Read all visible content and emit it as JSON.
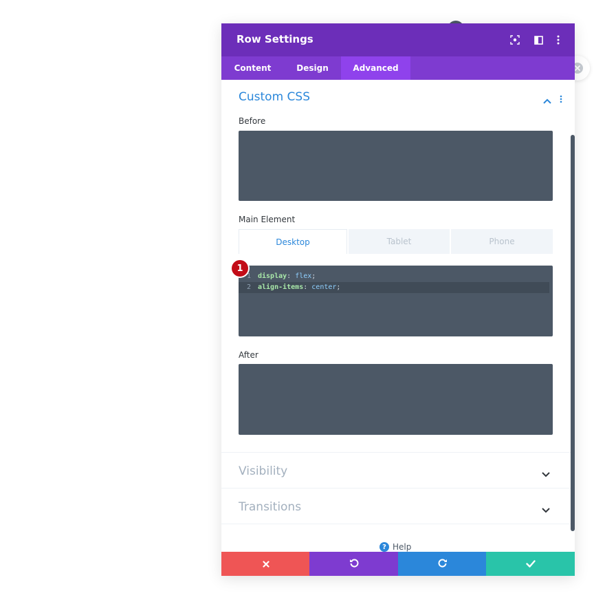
{
  "modal": {
    "title": "Row Settings",
    "header_icons": [
      "focus-icon",
      "split-view-icon",
      "more-vertical-icon"
    ]
  },
  "tabs": [
    {
      "label": "Content",
      "active": false
    },
    {
      "label": "Design",
      "active": false
    },
    {
      "label": "Advanced",
      "active": true
    }
  ],
  "custom_css": {
    "title": "Custom CSS",
    "before_label": "Before",
    "main_element_label": "Main Element",
    "after_label": "After",
    "device_tabs": [
      {
        "label": "Desktop",
        "active": true
      },
      {
        "label": "Tablet",
        "active": false
      },
      {
        "label": "Phone",
        "active": false
      }
    ],
    "code_lines": [
      {
        "num": "1",
        "prop": "display",
        "value": "flex"
      },
      {
        "num": "2",
        "prop": "align-items",
        "value": "center"
      }
    ]
  },
  "annotation": {
    "badge": "1"
  },
  "sections": [
    {
      "label": "Visibility"
    },
    {
      "label": "Transitions"
    }
  ],
  "help": {
    "label": "Help"
  },
  "colors": {
    "header": "#6c2eb9",
    "tab_bar": "#7e3bd0",
    "tab_active": "#8f42ec",
    "accent_blue": "#2b87da",
    "code_bg": "#4c5866",
    "cancel": "#ef5555",
    "undo": "#7e3bd0",
    "redo": "#2b87da",
    "save": "#29c4a9",
    "badge": "#c20c17"
  },
  "footer": {
    "buttons": [
      "cancel-icon",
      "undo-icon",
      "redo-icon",
      "save-check-icon"
    ]
  }
}
